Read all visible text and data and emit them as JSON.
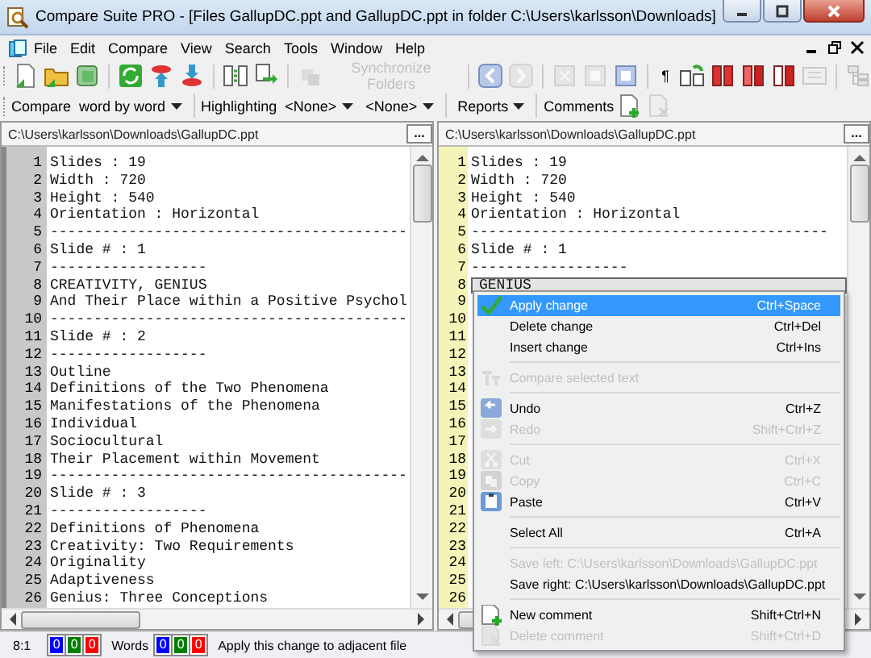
{
  "window": {
    "title": "Compare Suite PRO - [Files GallupDC.ppt and GallupDC.ppt in folder C:\\Users\\karlsson\\Downloads]"
  },
  "menu": [
    "File",
    "Edit",
    "Compare",
    "View",
    "Search",
    "Tools",
    "Window",
    "Help"
  ],
  "toolbar": [
    {
      "kind": "icon",
      "disabled": false
    },
    {
      "kind": "icon",
      "disabled": false
    },
    {
      "kind": "icon",
      "disabled": false
    },
    {
      "kind": "sep"
    },
    {
      "kind": "icon",
      "disabled": false
    },
    {
      "kind": "icon",
      "disabled": false
    },
    {
      "kind": "icon",
      "disabled": false
    },
    {
      "kind": "sep"
    },
    {
      "kind": "icon",
      "disabled": false
    },
    {
      "kind": "icon",
      "disabled": false
    },
    {
      "kind": "sep"
    },
    {
      "kind": "button",
      "label": "Synchronize Folders",
      "disabled": true
    },
    {
      "kind": "sep"
    },
    {
      "kind": "icon",
      "disabled": false
    },
    {
      "kind": "icon",
      "disabled": true
    },
    {
      "kind": "sep"
    },
    {
      "kind": "icon",
      "disabled": true
    },
    {
      "kind": "icon",
      "disabled": true
    },
    {
      "kind": "icon",
      "disabled": false
    },
    {
      "kind": "sep"
    },
    {
      "kind": "glyph",
      "label": "¶"
    },
    {
      "kind": "icon",
      "disabled": false
    },
    {
      "kind": "icon",
      "disabled": false
    },
    {
      "kind": "icon",
      "disabled": false
    },
    {
      "kind": "icon",
      "disabled": false
    },
    {
      "kind": "icon",
      "disabled": true
    },
    {
      "kind": "sep"
    },
    {
      "kind": "icon",
      "disabled": true
    }
  ],
  "toolbar2": [
    {
      "kind": "label",
      "label": "Compare"
    },
    {
      "kind": "dropdown",
      "label": "word by word"
    },
    {
      "kind": "sep"
    },
    {
      "kind": "label",
      "label": "Highlighting"
    },
    {
      "kind": "dropdown",
      "label": "<None>"
    },
    {
      "kind": "dropdown",
      "label": "<None>"
    },
    {
      "kind": "sep"
    },
    {
      "kind": "dropdown",
      "label": "Reports"
    },
    {
      "kind": "sep"
    },
    {
      "kind": "label",
      "label": "Comments"
    },
    {
      "kind": "icon",
      "disabled": false
    },
    {
      "kind": "icon",
      "disabled": true
    }
  ],
  "left": {
    "path": "C:\\Users\\karlsson\\Downloads\\GallupDC.ppt",
    "browse": "...",
    "lines": [
      {
        "n": "1",
        "text": "Slides : 19",
        "changed": false
      },
      {
        "n": "2",
        "text": "Width : 720",
        "changed": false
      },
      {
        "n": "3",
        "text": "Height : 540",
        "changed": false
      },
      {
        "n": "4",
        "text": "Orientation : Horizontal",
        "changed": false
      },
      {
        "n": "5",
        "text": "-----------------------------------------",
        "changed": false
      },
      {
        "n": "6",
        "text": "Slide # : 1",
        "changed": false
      },
      {
        "n": "7",
        "text": "------------------",
        "changed": false
      },
      {
        "n": "8",
        "text": "CREATIVITY, GENIUS",
        "changed": false
      },
      {
        "n": "9",
        "text": "And Their Place within a Positive Psychol",
        "changed": false
      },
      {
        "n": "10",
        "text": "-----------------------------------------",
        "changed": false
      },
      {
        "n": "11",
        "text": "Slide # : 2",
        "changed": false
      },
      {
        "n": "12",
        "text": "------------------",
        "changed": false
      },
      {
        "n": "13",
        "text": "Outline",
        "changed": false
      },
      {
        "n": "14",
        "text": "Definitions of the Two Phenomena",
        "changed": false
      },
      {
        "n": "15",
        "text": "Manifestations of the Phenomena",
        "changed": false
      },
      {
        "n": "16",
        "text": "Individual",
        "changed": false
      },
      {
        "n": "17",
        "text": "Sociocultural",
        "changed": false
      },
      {
        "n": "18",
        "text": "Their Placement within Movement",
        "changed": false
      },
      {
        "n": "19",
        "text": "-----------------------------------------",
        "changed": false
      },
      {
        "n": "20",
        "text": "Slide # : 3",
        "changed": false
      },
      {
        "n": "21",
        "text": "------------------",
        "changed": false
      },
      {
        "n": "22",
        "text": "Definitions of Phenomena",
        "changed": false
      },
      {
        "n": "23",
        "text": "Creativity: Two Requirements",
        "changed": false
      },
      {
        "n": "24",
        "text": "Originality",
        "changed": false
      },
      {
        "n": "25",
        "text": "Adaptiveness",
        "changed": false
      },
      {
        "n": "26",
        "text": "Genius: Three Conceptions",
        "changed": false
      }
    ]
  },
  "right": {
    "path": "C:\\Users\\karlsson\\Downloads\\GallupDC.ppt",
    "browse": "...",
    "lines": [
      {
        "n": "1",
        "text": "Slides : 19",
        "changed": false
      },
      {
        "n": "2",
        "text": "Width : 720",
        "changed": false
      },
      {
        "n": "3",
        "text": "Height : 540",
        "changed": false
      },
      {
        "n": "4",
        "text": "Orientation : Horizontal",
        "changed": false
      },
      {
        "n": "5",
        "text": "-----------------------------------------",
        "changed": false
      },
      {
        "n": "6",
        "text": "Slide # : 1",
        "changed": false
      },
      {
        "n": "7",
        "text": "------------------",
        "changed": false
      },
      {
        "n": "8",
        "text": "GENIUS",
        "changed": true
      },
      {
        "n": "9"
      },
      {
        "n": "10"
      },
      {
        "n": "11"
      },
      {
        "n": "12"
      },
      {
        "n": "13"
      },
      {
        "n": "14"
      },
      {
        "n": "15"
      },
      {
        "n": "16"
      },
      {
        "n": "17"
      },
      {
        "n": "18"
      },
      {
        "n": "19"
      },
      {
        "n": "20"
      },
      {
        "n": "21"
      },
      {
        "n": "22"
      },
      {
        "n": "23"
      },
      {
        "n": "24"
      },
      {
        "n": "25"
      },
      {
        "n": "26"
      }
    ]
  },
  "context_menu": [
    {
      "kind": "item",
      "label": "Apply change",
      "shortcut": "Ctrl+Space",
      "disabled": false,
      "selected": true
    },
    {
      "kind": "item",
      "label": "Delete change",
      "shortcut": "Ctrl+Del",
      "disabled": false,
      "selected": false
    },
    {
      "kind": "item",
      "label": "Insert change",
      "shortcut": "Ctrl+Ins",
      "disabled": false,
      "selected": false
    },
    {
      "kind": "sep"
    },
    {
      "kind": "item",
      "label": "Compare selected text",
      "disabled": true,
      "selected": false
    },
    {
      "kind": "sep"
    },
    {
      "kind": "item",
      "label": "Undo",
      "shortcut": "Ctrl+Z",
      "disabled": false,
      "selected": false
    },
    {
      "kind": "item",
      "label": "Redo",
      "shortcut": "Shift+Ctrl+Z",
      "disabled": true,
      "selected": false
    },
    {
      "kind": "sep"
    },
    {
      "kind": "item",
      "label": "Cut",
      "shortcut": "Ctrl+X",
      "disabled": true,
      "selected": false
    },
    {
      "kind": "item",
      "label": "Copy",
      "shortcut": "Ctrl+C",
      "disabled": true,
      "selected": false
    },
    {
      "kind": "item",
      "label": "Paste",
      "shortcut": "Ctrl+V",
      "disabled": false,
      "selected": false
    },
    {
      "kind": "sep"
    },
    {
      "kind": "item",
      "label": "Select All",
      "shortcut": "Ctrl+A",
      "disabled": false,
      "selected": false
    },
    {
      "kind": "sep"
    },
    {
      "kind": "item",
      "label": "Save left: C:\\Users\\karlsson\\Downloads\\GallupDC.ppt",
      "disabled": true,
      "selected": false
    },
    {
      "kind": "item",
      "label": "Save right: C:\\Users\\karlsson\\Downloads\\GallupDC.ppt",
      "disabled": false,
      "selected": false
    },
    {
      "kind": "sep"
    },
    {
      "kind": "item",
      "label": "New comment",
      "shortcut": "Shift+Ctrl+N",
      "disabled": false,
      "selected": false
    },
    {
      "kind": "item",
      "label": "Delete comment",
      "shortcut": "Shift+Ctrl+D",
      "disabled": true,
      "selected": false
    }
  ],
  "status_bar": [
    {
      "kind": "text",
      "label": "8:1"
    },
    {
      "kind": "count",
      "label": "0",
      "color": "#0000ff"
    },
    {
      "kind": "count",
      "label": "0",
      "color": "#008000"
    },
    {
      "kind": "count",
      "label": "0",
      "color": "#ff0000"
    },
    {
      "kind": "text",
      "label": "Words"
    },
    {
      "kind": "count",
      "label": "0",
      "color": "#0000ff"
    },
    {
      "kind": "count",
      "label": "0",
      "color": "#008000"
    },
    {
      "kind": "count",
      "label": "0",
      "color": "#ff0000"
    },
    {
      "kind": "text",
      "label": "Apply this change to adjacent file"
    }
  ]
}
